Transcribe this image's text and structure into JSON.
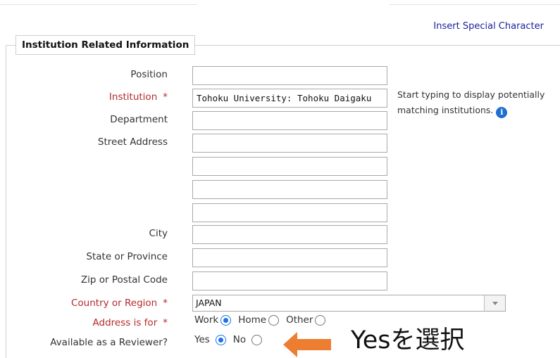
{
  "header": {
    "special_char_link": "Insert Special Character"
  },
  "section": {
    "legend": "Institution Related Information"
  },
  "fields": {
    "position": {
      "label": "Position",
      "value": ""
    },
    "institution": {
      "label": "Institution",
      "required_mark": "*",
      "value": "Tohoku University: Tohoku Daigaku"
    },
    "institution_hint": "Start typing to display potentially matching institutions.",
    "department": {
      "label": "Department",
      "value": ""
    },
    "street_address": {
      "label": "Street Address",
      "line1": "",
      "line2": "",
      "line3": "",
      "line4": ""
    },
    "city": {
      "label": "City",
      "value": ""
    },
    "state": {
      "label": "State or Province",
      "value": ""
    },
    "zip": {
      "label": "Zip or Postal Code",
      "value": ""
    },
    "country": {
      "label": "Country or Region",
      "required_mark": "*",
      "value": "JAPAN"
    },
    "address_is_for": {
      "label": "Address is for",
      "required_mark": "*",
      "options": [
        "Work",
        "Home",
        "Other"
      ],
      "selected": "Work"
    },
    "reviewer": {
      "label": "Available as a Reviewer?",
      "options": [
        "Yes",
        "No"
      ],
      "selected": "Yes"
    }
  },
  "annotation": {
    "text": "Yesを選択",
    "arrow_color": "#ed7d31"
  },
  "colors": {
    "link": "#1a1f9c",
    "required": "#b52a2a",
    "radio_checked": "#1a73e8",
    "info_icon": "#1f6fd1"
  }
}
